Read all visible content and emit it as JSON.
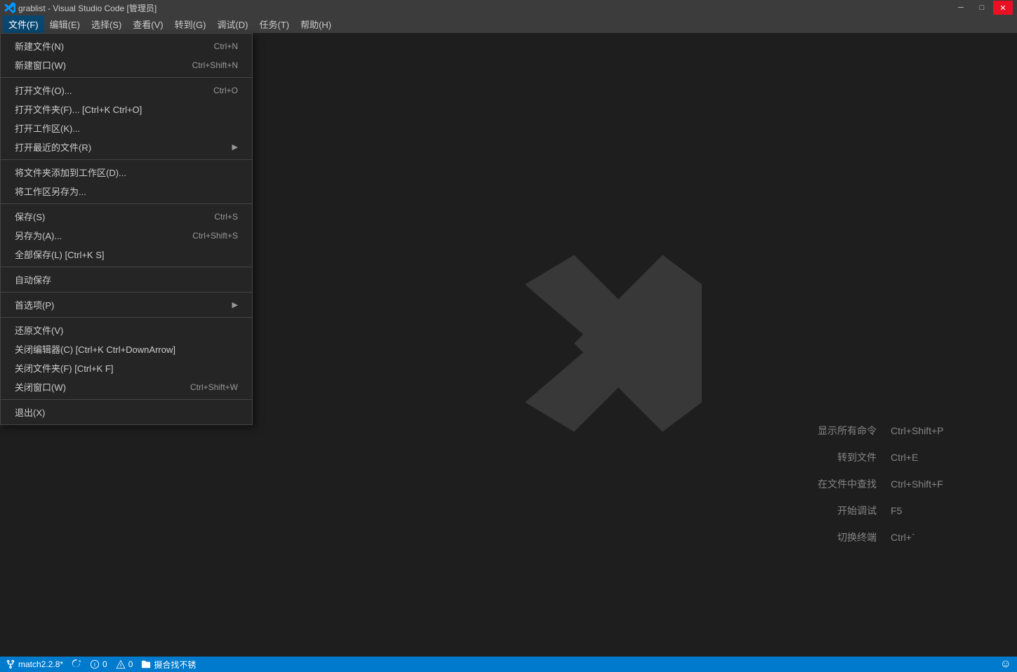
{
  "titleBar": {
    "title": "grablist - Visual Studio Code [管理员]",
    "controls": {
      "minimize": "─",
      "maximize": "□",
      "close": "✕"
    }
  },
  "menuBar": {
    "items": [
      {
        "label": "文件(F)",
        "active": true
      },
      {
        "label": "编辑(E)",
        "active": false
      },
      {
        "label": "选择(S)",
        "active": false
      },
      {
        "label": "查看(V)",
        "active": false
      },
      {
        "label": "转到(G)",
        "active": false
      },
      {
        "label": "调试(D)",
        "active": false
      },
      {
        "label": "任务(T)",
        "active": false
      },
      {
        "label": "帮助(H)",
        "active": false
      }
    ]
  },
  "fileMenu": {
    "items": [
      {
        "id": "new-file",
        "label": "新建文件(N)",
        "shortcut": "Ctrl+N",
        "hasArrow": false,
        "separator_before": false,
        "separator_after": false
      },
      {
        "id": "new-window",
        "label": "新建窗口(W)",
        "shortcut": "Ctrl+Shift+N",
        "hasArrow": false,
        "separator_before": false,
        "separator_after": true
      },
      {
        "id": "open-file",
        "label": "打开文件(O)...",
        "shortcut": "Ctrl+O",
        "hasArrow": false,
        "separator_before": false,
        "separator_after": false
      },
      {
        "id": "open-folder",
        "label": "打开文件夹(F)... [Ctrl+K Ctrl+O]",
        "shortcut": "",
        "hasArrow": false,
        "separator_before": false,
        "separator_after": false
      },
      {
        "id": "open-workspace",
        "label": "打开工作区(K)...",
        "shortcut": "",
        "hasArrow": false,
        "separator_before": false,
        "separator_after": false
      },
      {
        "id": "open-recent",
        "label": "打开最近的文件(R)",
        "shortcut": "",
        "hasArrow": true,
        "separator_before": false,
        "separator_after": true
      },
      {
        "id": "add-folder",
        "label": "将文件夹添加到工作区(D)...",
        "shortcut": "",
        "hasArrow": false,
        "separator_before": false,
        "separator_after": false
      },
      {
        "id": "save-workspace",
        "label": "将工作区另存为...",
        "shortcut": "",
        "hasArrow": false,
        "separator_before": false,
        "separator_after": true
      },
      {
        "id": "save",
        "label": "保存(S)",
        "shortcut": "Ctrl+S",
        "hasArrow": false,
        "separator_before": false,
        "separator_after": false
      },
      {
        "id": "save-as",
        "label": "另存为(A)...",
        "shortcut": "Ctrl+Shift+S",
        "hasArrow": false,
        "separator_before": false,
        "separator_after": false
      },
      {
        "id": "save-all",
        "label": "全部保存(L) [Ctrl+K S]",
        "shortcut": "",
        "hasArrow": false,
        "separator_before": false,
        "separator_after": true
      },
      {
        "id": "auto-save",
        "label": "自动保存",
        "shortcut": "",
        "hasArrow": false,
        "separator_before": false,
        "separator_after": true
      },
      {
        "id": "preferences",
        "label": "首选项(P)",
        "shortcut": "",
        "hasArrow": true,
        "separator_before": false,
        "separator_after": true
      },
      {
        "id": "revert",
        "label": "还原文件(V)",
        "shortcut": "",
        "hasArrow": false,
        "separator_before": false,
        "separator_after": false
      },
      {
        "id": "close-editor",
        "label": "关闭编辑器(C) [Ctrl+K Ctrl+DownArrow]",
        "shortcut": "",
        "hasArrow": false,
        "separator_before": false,
        "separator_after": false
      },
      {
        "id": "close-folder",
        "label": "关闭文件夹(F) [Ctrl+K F]",
        "shortcut": "",
        "hasArrow": false,
        "separator_before": false,
        "separator_after": false
      },
      {
        "id": "close-window",
        "label": "关闭窗口(W)",
        "shortcut": "Ctrl+Shift+W",
        "hasArrow": false,
        "separator_before": false,
        "separator_after": true
      },
      {
        "id": "exit",
        "label": "退出(X)",
        "shortcut": "",
        "hasArrow": false,
        "separator_before": false,
        "separator_after": false
      }
    ]
  },
  "shortcuts": [
    {
      "label": "显示所有命令",
      "key": "Ctrl+Shift+P"
    },
    {
      "label": "转到文件",
      "key": "Ctrl+E"
    },
    {
      "label": "在文件中查找",
      "key": "Ctrl+Shift+F"
    },
    {
      "label": "开始调试",
      "key": "F5"
    },
    {
      "label": "切换终端",
      "key": "Ctrl+`"
    }
  ],
  "statusBar": {
    "branch": "match2.2.8*",
    "sync": "sync-icon",
    "errors": "0",
    "warnings": "0",
    "folder": "摄合找不锈"
  }
}
